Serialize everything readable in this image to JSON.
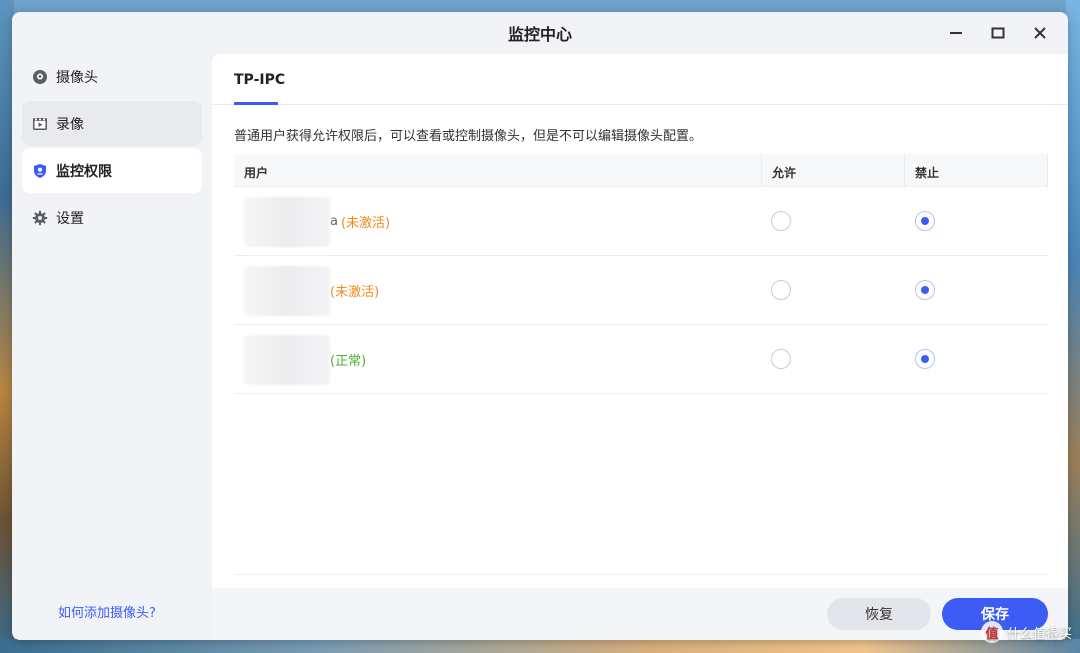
{
  "window": {
    "title": "监控中心",
    "controls": {
      "minimize": "—",
      "maximize": "□",
      "close": "✕"
    }
  },
  "sidebar": {
    "items": [
      {
        "label": "摄像头",
        "icon": "camera-icon",
        "state": "normal"
      },
      {
        "label": "录像",
        "icon": "recording-icon",
        "state": "hover"
      },
      {
        "label": "监控权限",
        "icon": "shield-user-icon",
        "state": "active"
      },
      {
        "label": "设置",
        "icon": "gear-icon",
        "state": "normal"
      }
    ],
    "help_link": "如何添加摄像头?"
  },
  "main": {
    "tab": "TP-IPC",
    "description": "普通用户获得允许权限后，可以查看或控制摄像头，但是不可以编辑摄像头配置。",
    "table": {
      "headers": {
        "user": "用户",
        "allow": "允许",
        "deny": "禁止"
      },
      "rows": [
        {
          "name_tail": "a",
          "status": "(未激活)",
          "status_color": "#f08a1c",
          "permission": "禁止"
        },
        {
          "name_tail": "",
          "status": "(未激活)",
          "status_color": "#f08a1c",
          "permission": "禁止"
        },
        {
          "name_tail": "",
          "status": "(正常)",
          "status_color": "#4caf2a",
          "permission": "禁止"
        }
      ]
    }
  },
  "footer": {
    "reset_label": "恢复",
    "save_label": "保存"
  },
  "watermark": {
    "badge": "值",
    "text": "什么值得买"
  },
  "colors": {
    "accent": "#3d5cf5",
    "inactive_status": "#f08a1c",
    "normal_status": "#4caf2a"
  }
}
